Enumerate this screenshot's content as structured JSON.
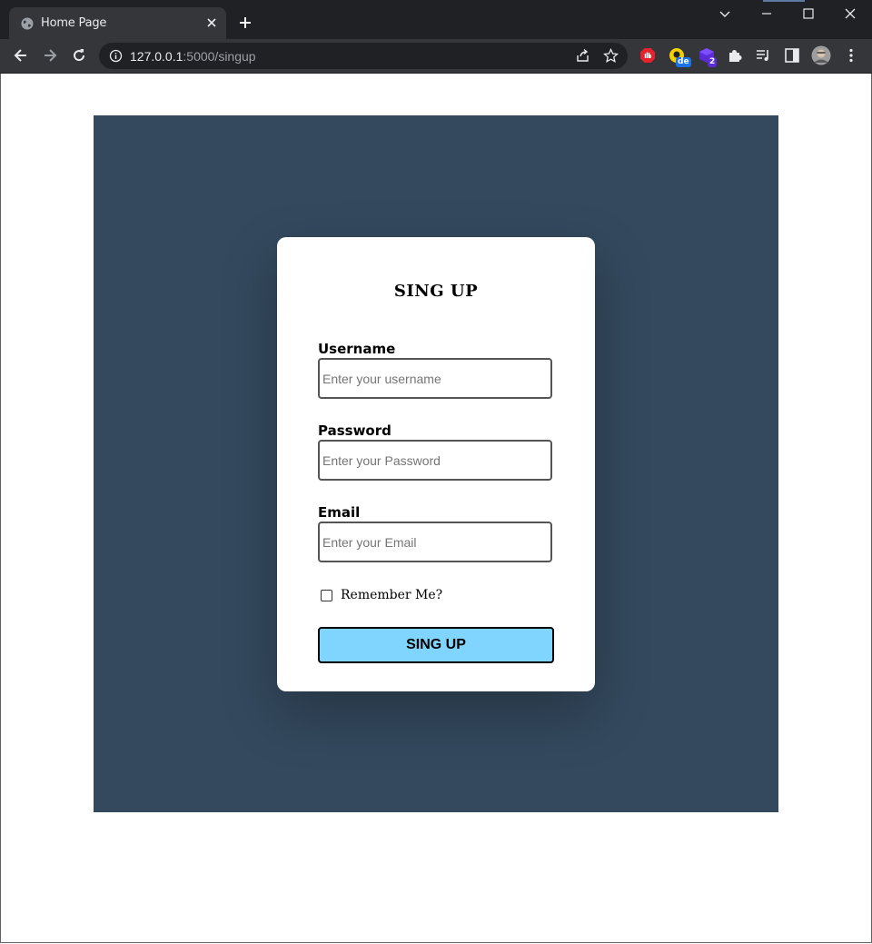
{
  "browser": {
    "tab_title": "Home Page",
    "url_host": "127.0.0.1",
    "url_path": ":5000/singup",
    "extensions": [
      {
        "name": "adblock-extension",
        "badge": ""
      },
      {
        "name": "dictionary-extension",
        "badge": "de"
      },
      {
        "name": "purple-extension",
        "badge": "2"
      }
    ]
  },
  "form": {
    "title": "SING UP",
    "fields": [
      {
        "label": "Username",
        "placeholder": "Enter your username",
        "value": ""
      },
      {
        "label": "Password",
        "placeholder": "Enter your Password",
        "value": ""
      },
      {
        "label": "Email",
        "placeholder": "Enter your Email",
        "value": ""
      }
    ],
    "remember_label": "Remember Me?",
    "remember_checked": false,
    "submit_label": "SING UP"
  },
  "colors": {
    "panel_bg": "#34495e",
    "button_bg": "#7fd5fd",
    "card_bg": "#ffffff"
  }
}
